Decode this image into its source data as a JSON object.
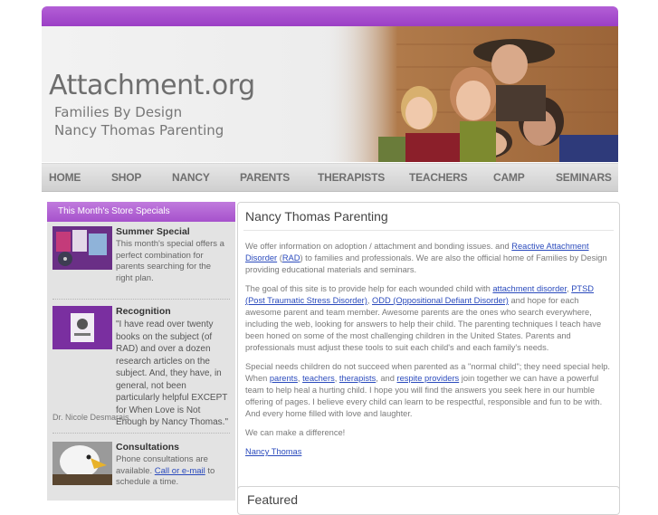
{
  "header": {
    "logo_title": "Attachment.org",
    "logo_line1": "Families By Design",
    "logo_line2": "Nancy Thomas Parenting"
  },
  "nav": [
    "HOME",
    "SHOP",
    "NANCY",
    "PARENTS",
    "THERAPISTS",
    "TEACHERS",
    "CAMP",
    "SEMINARS"
  ],
  "sidebar": {
    "heading": "This Month's Store Specials",
    "items": [
      {
        "title": "Summer Special",
        "text": "This month's special offers a perfect combination for parents searching for the right plan."
      },
      {
        "title": "Recognition",
        "text": "\"I have read over twenty books on the subject (of RAD) and over a dozen research articles on the subject. And, they have, in general, not been particularly helpful EXCEPT for When Love is Not Enough by Nancy Thomas.\"",
        "attribution": "Dr. Nicole Desmarais"
      },
      {
        "title": "Consultations",
        "text_before": "Phone consultations are available.",
        "link": "Call or e-mail",
        "text_after": "to schedule a time."
      }
    ]
  },
  "main": {
    "title": "Nancy Thomas Parenting",
    "p1": {
      "t1": "We offer information on adoption / attachment and bonding issues. and ",
      "l1": "Reactive Attachment Disorder",
      "t2": " (",
      "l2": "RAD",
      "t3": ") to families and professionals. We are also the official home of Families by Design providing educational materials and seminars."
    },
    "p2": {
      "t1": "The goal of this site is to provide help for each wounded child with ",
      "l1": "attachment disorder",
      "t2": ", ",
      "l2": "PTSD (Post Traumatic Stress Disorder)",
      "t3": ", ",
      "l3": "ODD (Oppositional Defiant Disorder)",
      "t4": " and hope for each awesome parent and team member. Awesome parents are the ones who search everywhere, including the web, looking for answers to help their child. The parenting techniques I teach have been honed on some of the most challenging children in the United States. Parents and professionals must adjust these tools to suit each child's and each family's needs."
    },
    "p3": {
      "t1": "Special needs children do not succeed when parented as a \"normal child\"; they need special help. When ",
      "l1": "parents",
      "t2": ", ",
      "l2": "teachers",
      "t3": ", ",
      "l3": "therapists",
      "t4": ", and ",
      "l4": "respite providers",
      "t5": " join together we can have a powerful team to help heal a hurting child. I hope you will find the answers you seek here in our humble offering of pages. I believe every child can learn to be respectful, responsible and fun to be with. And every home filled with love and laughter."
    },
    "p4": "We can make a difference!",
    "signature": "Nancy Thomas"
  },
  "second_box": {
    "title": "Featured"
  },
  "colors": {
    "accent": "#a651cc",
    "link": "#2b4bbd"
  }
}
